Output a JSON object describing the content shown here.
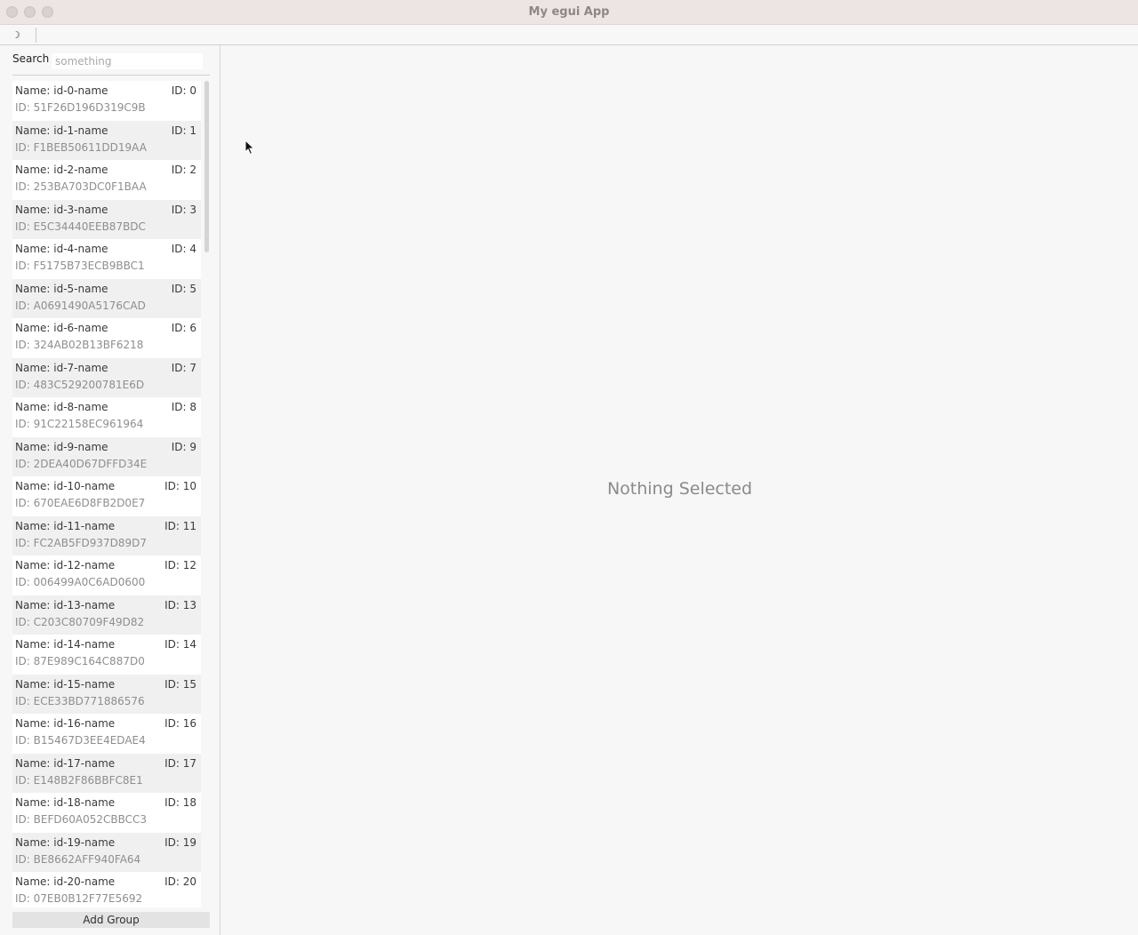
{
  "window": {
    "title": "My egui App"
  },
  "toolbar": {
    "theme_icon": "moon-icon",
    "theme_glyph": "☽"
  },
  "sidebar": {
    "search_label": "Search",
    "search_placeholder": "something",
    "items": [
      {
        "name": "Name: id-0-name",
        "index": "ID: 0",
        "id": "ID: 51F26D196D319C9B"
      },
      {
        "name": "Name: id-1-name",
        "index": "ID: 1",
        "id": "ID: F1BEB50611DD19AA"
      },
      {
        "name": "Name: id-2-name",
        "index": "ID: 2",
        "id": "ID: 253BA703DC0F1BAA"
      },
      {
        "name": "Name: id-3-name",
        "index": "ID: 3",
        "id": "ID: E5C34440EEB87BDC"
      },
      {
        "name": "Name: id-4-name",
        "index": "ID: 4",
        "id": "ID: F5175B73ECB9BBC1"
      },
      {
        "name": "Name: id-5-name",
        "index": "ID: 5",
        "id": "ID: A0691490A5176CAD"
      },
      {
        "name": "Name: id-6-name",
        "index": "ID: 6",
        "id": "ID: 324AB02B13BF6218"
      },
      {
        "name": "Name: id-7-name",
        "index": "ID: 7",
        "id": "ID: 483C529200781E6D"
      },
      {
        "name": "Name: id-8-name",
        "index": "ID: 8",
        "id": "ID: 91C22158EC961964"
      },
      {
        "name": "Name: id-9-name",
        "index": "ID: 9",
        "id": "ID: 2DEA40D67DFFD34E"
      },
      {
        "name": "Name: id-10-name",
        "index": "ID: 10",
        "id": "ID: 670EAE6D8FB2D0E7"
      },
      {
        "name": "Name: id-11-name",
        "index": "ID: 11",
        "id": "ID: FC2AB5FD937D89D7"
      },
      {
        "name": "Name: id-12-name",
        "index": "ID: 12",
        "id": "ID: 006499A0C6AD0600"
      },
      {
        "name": "Name: id-13-name",
        "index": "ID: 13",
        "id": "ID: C203C80709F49D82"
      },
      {
        "name": "Name: id-14-name",
        "index": "ID: 14",
        "id": "ID: 87E989C164C887D0"
      },
      {
        "name": "Name: id-15-name",
        "index": "ID: 15",
        "id": "ID: ECE33BD771886576"
      },
      {
        "name": "Name: id-16-name",
        "index": "ID: 16",
        "id": "ID: B15467D3EE4EDAE4"
      },
      {
        "name": "Name: id-17-name",
        "index": "ID: 17",
        "id": "ID: E148B2F86BBFC8E1"
      },
      {
        "name": "Name: id-18-name",
        "index": "ID: 18",
        "id": "ID: BEFD60A052CBBCC3"
      },
      {
        "name": "Name: id-19-name",
        "index": "ID: 19",
        "id": "ID: BE8662AFF940FA64"
      },
      {
        "name": "Name: id-20-name",
        "index": "ID: 20",
        "id": "ID: 07EB0B12F77E5692"
      }
    ],
    "add_group_label": "Add Group"
  },
  "main": {
    "empty_message": "Nothing Selected"
  },
  "colors": {
    "titlebar": "#ede5e3",
    "panel": "#f7f7f7",
    "row_light": "#ffffff",
    "row_dark": "#f0f0f0"
  }
}
